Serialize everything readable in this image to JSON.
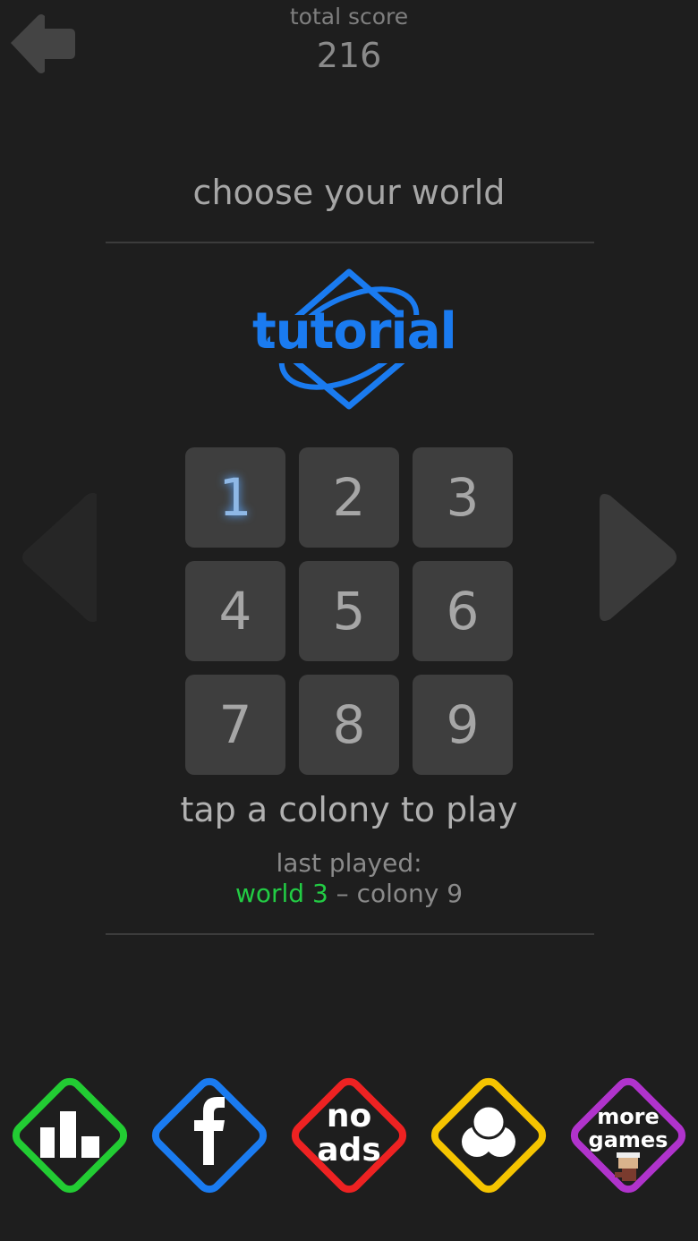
{
  "header": {
    "score_label": "total score",
    "score_value": "216",
    "back_icon": "arrow-left-icon"
  },
  "title": "choose your world",
  "tutorial": {
    "label": "tutorial",
    "color": "#1a7bf0"
  },
  "levels": [
    "1",
    "2",
    "3",
    "4",
    "5",
    "6",
    "7",
    "8",
    "9"
  ],
  "current_level": "1",
  "nav": {
    "prev_icon": "triangle-left-icon",
    "next_icon": "triangle-right-icon"
  },
  "hint": "tap a colony to play",
  "last_played": {
    "label": "last played:",
    "world": "world 3",
    "separator": " – ",
    "colony": "colony 9",
    "world_color": "#22cc44"
  },
  "bottom_buttons": [
    {
      "name": "leaderboard",
      "icon": "bar-chart-icon",
      "color": "#22cc33"
    },
    {
      "name": "facebook",
      "icon": "facebook-icon",
      "color": "#1a7bf0"
    },
    {
      "name": "no-ads",
      "label_line1": "no",
      "label_line2": "ads",
      "color": "#ee2222"
    },
    {
      "name": "achievements",
      "icon": "users-icon",
      "color": "#f5c400"
    },
    {
      "name": "more-games",
      "label_line1": "more",
      "label_line2": "games",
      "icon": "character-icon",
      "color": "#b033cc"
    }
  ]
}
